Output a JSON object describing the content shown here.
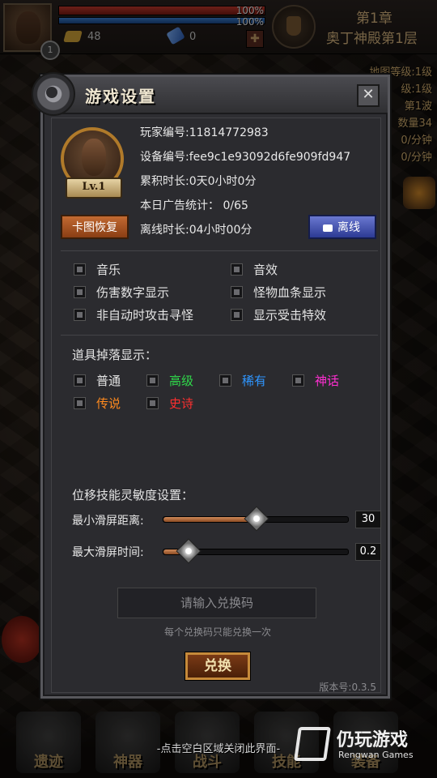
{
  "hud": {
    "hp_text": "100%",
    "mp_text": "100%",
    "gold": "48",
    "gems": "0",
    "player_level": "1",
    "chapter": "第1章",
    "stage_name": "奥丁神殿第1层",
    "side_info": [
      "地图等级:1级",
      "级:1级",
      "第1波",
      "数量34",
      "0/分钟",
      "0/分钟"
    ]
  },
  "modal": {
    "title": "游戏设置",
    "close_label": "✕",
    "avatar_level": "Lv.1",
    "info": {
      "player_id": "玩家编号:11814772983",
      "device_id": "设备编号:fee9c1e93092d6fe909fd947",
      "total_time": "累积时长:0天0小时0分",
      "ad_stats": "本日广告统计： 0/65",
      "offline_time": "离线时长:04小时00分"
    },
    "restore_btn": "卡图恢复",
    "offline_btn": "离线",
    "options": [
      {
        "label": "音乐"
      },
      {
        "label": "音效"
      },
      {
        "label": "伤害数字显示"
      },
      {
        "label": "怪物血条显示"
      },
      {
        "label": "非自动时攻击寻怪"
      },
      {
        "label": "显示受击特效"
      }
    ],
    "drop_title": "道具掉落显示：",
    "drops": [
      {
        "label": "普通",
        "color": "#e4e4e4"
      },
      {
        "label": "高级",
        "color": "#2fd94a"
      },
      {
        "label": "稀有",
        "color": "#2f96ff"
      },
      {
        "label": "神话",
        "color": "#ff2fd2"
      },
      {
        "label": "传说",
        "color": "#ff8a1e"
      },
      {
        "label": "史诗",
        "color": "#ff2f2f"
      }
    ],
    "sensitivity_title": "位移技能灵敏度设置：",
    "sliders": [
      {
        "label": "最小滑屏距离:",
        "value": "30",
        "fraction": 0.5
      },
      {
        "label": "最大滑屏时间:",
        "value": "0.2",
        "fraction": 0.13
      }
    ],
    "code_placeholder": "请输入兑换码",
    "code_hint": "每个兑换码只能兑换一次",
    "redeem_btn": "兑换",
    "version": "版本号:0.3.5"
  },
  "footer": {
    "close_hint": "-点击空白区域关闭此界面-",
    "nav": [
      "遗迹",
      "神器",
      "战斗",
      "技能",
      "装备"
    ],
    "watermark_cn": "仍玩游戏",
    "watermark_en": "Rengwan Games"
  }
}
